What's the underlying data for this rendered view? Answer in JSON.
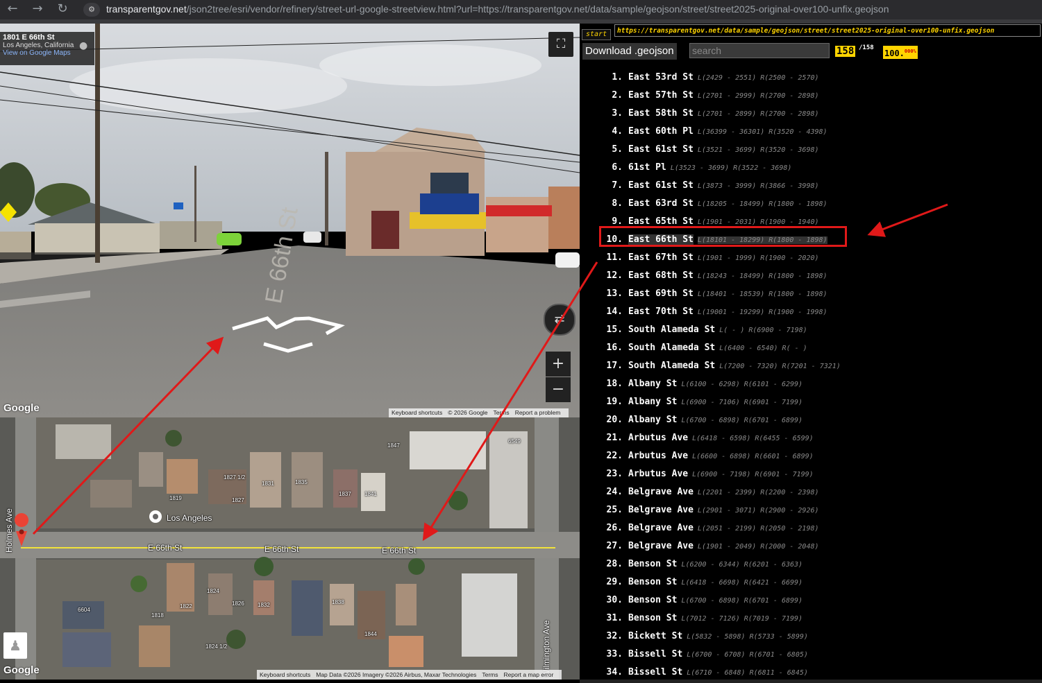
{
  "browser": {
    "url_host": "transparentgov.net",
    "url_path": "/json2tree/esri/vendor/refinery/street-url-google-streetview.html?url=https://transparentgov.net/data/sample/geojson/street/street2025-original-over100-unfix.geojson"
  },
  "streetview": {
    "address": "1801 E 66th St",
    "city": "Los Angeles, California",
    "maps_link": "View on Google Maps",
    "road_marking": "E 66th St",
    "google": "Google",
    "footer": [
      "Keyboard shortcuts",
      "© 2026 Google",
      "Terms",
      "Report a problem"
    ]
  },
  "map": {
    "street_labels": [
      "E 66th St",
      "E 66th St",
      "E 66th St"
    ],
    "left_road": "Holmes Ave",
    "right_road": "Wilmington Ave",
    "place_label": "Los Angeles",
    "parcel_numbers": [
      "1847",
      "6549",
      "1827 1/2",
      "1831",
      "1835",
      "1837",
      "1841",
      "1819",
      "1827",
      "1824",
      "1826",
      "1832",
      "1838",
      "1822",
      "1818",
      "6604",
      "1844",
      "1824 1/2"
    ],
    "google": "Google",
    "footer": [
      "Keyboard shortcuts",
      "Map Data ©2026 Imagery ©2026 Airbus, Maxar Technologies",
      "Terms",
      "Report a map error"
    ]
  },
  "panel": {
    "start_label": "start",
    "source_url": "https://transparentgov.net/data/sample/geojson/street/street2025-original-over100-unfix.geojson",
    "download_label": "Download .geojson",
    "search_placeholder": "search",
    "count_shown": "158",
    "count_total": "/158",
    "percent": "100.",
    "percent_sup": "000%",
    "selected_index": 9,
    "streets": [
      {
        "num": "1.",
        "name": "East 53rd St",
        "range": "L(2429 - 2551) R(2500 - 2570)"
      },
      {
        "num": "2.",
        "name": "East 57th St",
        "range": "L(2701 - 2999) R(2700 - 2898)"
      },
      {
        "num": "3.",
        "name": "East 58th St",
        "range": "L(2701 - 2899) R(2700 - 2898)"
      },
      {
        "num": "4.",
        "name": "East 60th Pl",
        "range": "L(36399 - 36301) R(3520 - 4398)"
      },
      {
        "num": "5.",
        "name": "East 61st St",
        "range": "L(3521 - 3699) R(3520 - 3698)"
      },
      {
        "num": "6.",
        "name": "61st Pl",
        "range": "L(3523 - 3699) R(3522 - 3698)"
      },
      {
        "num": "7.",
        "name": "East 61st St",
        "range": "L(3873 - 3999) R(3866 - 3998)"
      },
      {
        "num": "8.",
        "name": "East 63rd St",
        "range": "L(18205 - 18499) R(1800 - 1898)"
      },
      {
        "num": "9.",
        "name": "East 65th St",
        "range": "L(1901 - 2031) R(1900 - 1940)"
      },
      {
        "num": "10.",
        "name": "East 66th St",
        "range": "L(18101 - 18299) R(1800 - 1898)"
      },
      {
        "num": "11.",
        "name": "East 67th St",
        "range": "L(1901 - 1999) R(1900 - 2020)"
      },
      {
        "num": "12.",
        "name": "East 68th St",
        "range": "L(18243 - 18499) R(1800 - 1898)"
      },
      {
        "num": "13.",
        "name": "East 69th St",
        "range": "L(18401 - 18539) R(1800 - 1898)"
      },
      {
        "num": "14.",
        "name": "East 70th St",
        "range": "L(19001 - 19299) R(1900 - 1998)"
      },
      {
        "num": "15.",
        "name": "South Alameda St",
        "range": "L( - ) R(6900 - 7198)"
      },
      {
        "num": "16.",
        "name": "South Alameda St",
        "range": "L(6400 - 6540) R( - )"
      },
      {
        "num": "17.",
        "name": "South Alameda St",
        "range": "L(7200 - 7320) R(7201 - 7321)"
      },
      {
        "num": "18.",
        "name": "Albany St",
        "range": "L(6100 - 6298) R(6101 - 6299)"
      },
      {
        "num": "19.",
        "name": "Albany St",
        "range": "L(6900 - 7106) R(6901 - 7199)"
      },
      {
        "num": "20.",
        "name": "Albany St",
        "range": "L(6700 - 6898) R(6701 - 6899)"
      },
      {
        "num": "21.",
        "name": "Arbutus Ave",
        "range": "L(6418 - 6598) R(6455 - 6599)"
      },
      {
        "num": "22.",
        "name": "Arbutus Ave",
        "range": "L(6600 - 6898) R(6601 - 6899)"
      },
      {
        "num": "23.",
        "name": "Arbutus Ave",
        "range": "L(6900 - 7198) R(6901 - 7199)"
      },
      {
        "num": "24.",
        "name": "Belgrave Ave",
        "range": "L(2201 - 2399) R(2200 - 2398)"
      },
      {
        "num": "25.",
        "name": "Belgrave Ave",
        "range": "L(2901 - 3071) R(2900 - 2926)"
      },
      {
        "num": "26.",
        "name": "Belgrave Ave",
        "range": "L(2051 - 2199) R(2050 - 2198)"
      },
      {
        "num": "27.",
        "name": "Belgrave Ave",
        "range": "L(1901 - 2049) R(2000 - 2048)"
      },
      {
        "num": "28.",
        "name": "Benson St",
        "range": "L(6200 - 6344) R(6201 - 6363)"
      },
      {
        "num": "29.",
        "name": "Benson St",
        "range": "L(6418 - 6698) R(6421 - 6699)"
      },
      {
        "num": "30.",
        "name": "Benson St",
        "range": "L(6700 - 6898) R(6701 - 6899)"
      },
      {
        "num": "31.",
        "name": "Benson St",
        "range": "L(7012 - 7126) R(7019 - 7199)"
      },
      {
        "num": "32.",
        "name": "Bickett St",
        "range": "L(5832 - 5898) R(5733 - 5899)"
      },
      {
        "num": "33.",
        "name": "Bissell St",
        "range": "L(6700 - 6708) R(6701 - 6805)"
      },
      {
        "num": "34.",
        "name": "Bissell St",
        "range": "L(6710 - 6848) R(6811 - 6845)"
      }
    ]
  },
  "colors": {
    "accent_yellow": "#ffd400",
    "annotation_red": "#e01919",
    "map_street_line": "#f2e33a"
  }
}
